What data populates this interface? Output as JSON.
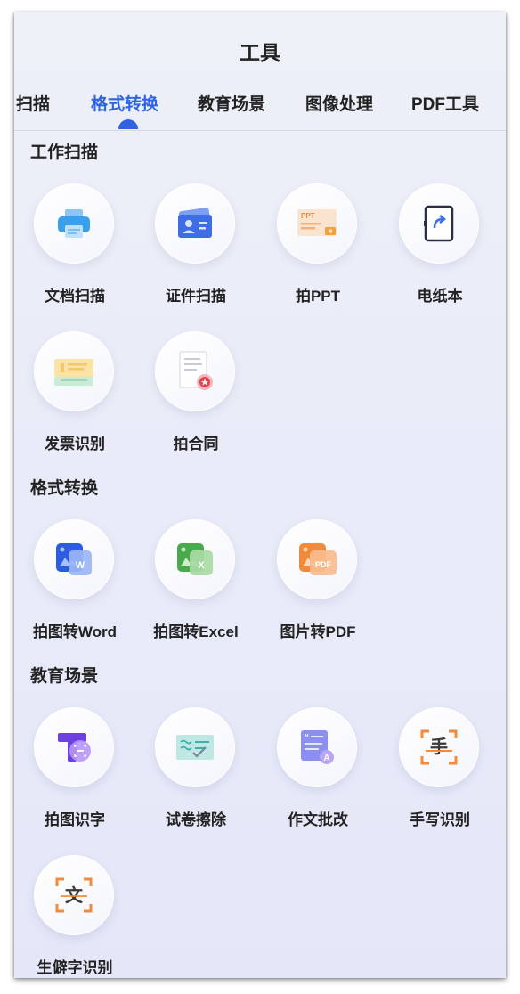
{
  "header": {
    "title": "工具"
  },
  "tabs": [
    {
      "label": "扫描",
      "active": false
    },
    {
      "label": "格式转换",
      "active": true
    },
    {
      "label": "教育场景",
      "active": false
    },
    {
      "label": "图像处理",
      "active": false
    },
    {
      "label": "PDF工具",
      "active": false
    }
  ],
  "sections": [
    {
      "title": "工作扫描",
      "tools": [
        {
          "label": "文档扫描",
          "icon": "printer-icon"
        },
        {
          "label": "证件扫描",
          "icon": "id-card-icon"
        },
        {
          "label": "拍PPT",
          "icon": "ppt-slide-icon"
        },
        {
          "label": "电纸本",
          "icon": "e-paper-icon"
        },
        {
          "label": "发票识别",
          "icon": "invoice-icon"
        },
        {
          "label": "拍合同",
          "icon": "contract-icon"
        }
      ]
    },
    {
      "title": "格式转换",
      "tools": [
        {
          "label": "拍图转Word",
          "icon": "word-icon",
          "badge": "W"
        },
        {
          "label": "拍图转Excel",
          "icon": "excel-icon",
          "badge": "X"
        },
        {
          "label": "图片转PDF",
          "icon": "pdf-icon",
          "badge": "PDF"
        }
      ]
    },
    {
      "title": "教育场景",
      "tools": [
        {
          "label": "拍图识字",
          "icon": "text-recognition-icon"
        },
        {
          "label": "试卷擦除",
          "icon": "paper-erase-icon"
        },
        {
          "label": "作文批改",
          "icon": "essay-correction-icon",
          "badge": "A"
        },
        {
          "label": "手写识别",
          "icon": "handwriting-icon",
          "badge": "手"
        },
        {
          "label": "生僻字识别",
          "icon": "rare-character-icon",
          "badge": "文"
        }
      ]
    }
  ],
  "colors": {
    "accent": "#2f63e0",
    "word": "#3b6cf0",
    "excel": "#5cb85c",
    "pdf": "#f08a3c"
  }
}
